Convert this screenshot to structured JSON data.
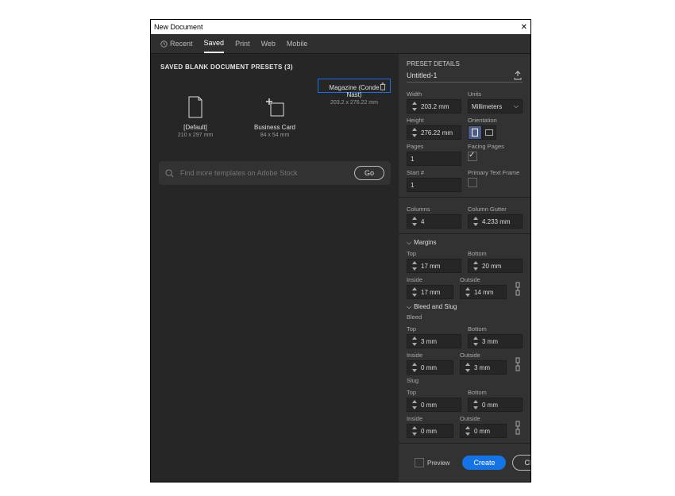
{
  "window": {
    "title": "New Document"
  },
  "tabs": {
    "recent": "Recent",
    "saved": "Saved",
    "print": "Print",
    "web": "Web",
    "mobile": "Mobile"
  },
  "section_header": "SAVED BLANK DOCUMENT PRESETS (3)",
  "presets": [
    {
      "name": "[Default]",
      "size": "210 x 297 mm"
    },
    {
      "name": "Business Card",
      "size": "84 x 54 mm"
    },
    {
      "name": "Magazine (Conde Nast)",
      "size": "203.2 x 276.22 mm"
    }
  ],
  "search": {
    "placeholder": "Find more templates on Adobe Stock",
    "go": "Go"
  },
  "details": {
    "header": "PRESET DETAILS",
    "name": "Untitled-1",
    "width_label": "Width",
    "width": "203.2 mm",
    "units_label": "Units",
    "units": "Millimeters",
    "height_label": "Height",
    "height": "276.22 mm",
    "orientation_label": "Orientation",
    "pages_label": "Pages",
    "pages": "1",
    "facing_label": "Facing Pages",
    "facing": true,
    "start_label": "Start #",
    "start": "1",
    "ptf_label": "Primary Text Frame",
    "ptf": false,
    "columns_label": "Columns",
    "columns": "4",
    "gutter_label": "Column Gutter",
    "gutter": "4.233 mm",
    "margins_header": "Margins",
    "top_label": "Top",
    "bottom_label": "Bottom",
    "inside_label": "Inside",
    "outside_label": "Outside",
    "m_top": "17 mm",
    "m_bottom": "20 mm",
    "m_inside": "17 mm",
    "m_outside": "14 mm",
    "bleedslug_header": "Bleed and Slug",
    "bleed_label": "Bleed",
    "slug_label": "Slug",
    "b_top": "3 mm",
    "b_bottom": "3 mm",
    "b_inside": "0 mm",
    "b_outside": "3 mm",
    "s_top": "0 mm",
    "s_bottom": "0 mm",
    "s_inside": "0 mm",
    "s_outside": "0 mm"
  },
  "footer": {
    "preview": "Preview",
    "create": "Create",
    "close": "Close"
  }
}
